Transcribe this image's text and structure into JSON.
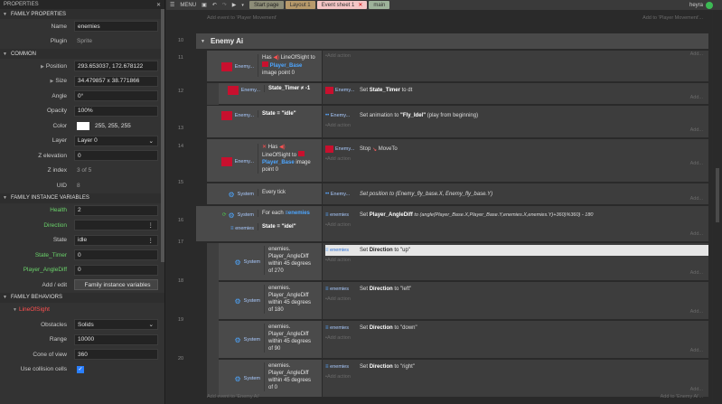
{
  "properties": {
    "title": "PROPERTIES",
    "sections": {
      "family_properties": "FAMILY PROPERTIES",
      "common": "COMMON",
      "instance_vars": "FAMILY INSTANCE VARIABLES",
      "behaviors": "FAMILY BEHAVIORS"
    },
    "name_label": "Name",
    "name_value": "enemies",
    "plugin_label": "Plugin",
    "plugin_value": "Sprite",
    "position_label": "Position",
    "position_value": "293.653037, 172.678122",
    "size_label": "Size",
    "size_value": "34.479857 x 38.771866",
    "angle_label": "Angle",
    "angle_value": "0°",
    "opacity_label": "Opacity",
    "opacity_value": "100%",
    "color_label": "Color",
    "color_value": "255, 255, 255",
    "layer_label": "Layer",
    "layer_value": "Layer 0",
    "zelev_label": "Z elevation",
    "zelev_value": "0",
    "zindex_label": "Z index",
    "zindex_value": "3 of 5",
    "uid_label": "UID",
    "uid_value": "8",
    "health_label": "Health",
    "health_value": "2",
    "direction_label": "Direction",
    "direction_value": "",
    "state_label": "State",
    "state_value": "idle",
    "statetimer_label": "State_Timer",
    "statetimer_value": "0",
    "angdiff_label": "Player_AngleDiff",
    "angdiff_value": "0",
    "addedit_label": "Add / edit",
    "addedit_button": "Family instance variables",
    "behavior_name": "LineOfSight",
    "obstacles_label": "Obstacles",
    "obstacles_value": "Solids",
    "range_label": "Range",
    "range_value": "10000",
    "cone_label": "Cone of view",
    "cone_value": "360",
    "usecoll_label": "Use collision cells"
  },
  "topbar": {
    "menu": "MENU",
    "tabs": [
      "Start page",
      "Layout 1",
      "Event sheet 1",
      "main"
    ],
    "user": "heyra"
  },
  "sheet": {
    "add_event_top": "Add event to 'Player Movement'",
    "add_to_top": "Add to 'Player Movement'...",
    "group_title": "Enemy Ai",
    "add_action": "Add action",
    "add": "Add...",
    "add_event_bottom": "Add event to 'Enemy Ai'",
    "add_to_bottom": "Add to 'Enemy Ai'...",
    "events": [
      {
        "num": "11",
        "cobj": "Enemy...",
        "ctext1": "Has",
        "ctext2": "LineOfSight to",
        "ctext3": "Player_Base",
        "ctext4": "image point 0"
      },
      {
        "num": "12",
        "cobj": "Enemy...",
        "ctext": "State_Timer ≠ -1",
        "aobj": "Enemy...",
        "atext_pre": "Set",
        "atext_b": "State_Timer",
        "atext_post": "to dt"
      },
      {
        "num": "13",
        "cobj": "Enemy...",
        "ctext": "State = \"idle\"",
        "aobj": "Enemy...",
        "atext_pre": "Set animation to",
        "atext_b": "\"Fly_Idel\"",
        "atext_post": "(play from beginning)"
      },
      {
        "num": "14",
        "cobj": "Enemy...",
        "ctext1": "Has",
        "ctext2": "LineOfSight to",
        "ctext3": "Player_Base",
        "ctext4": "image",
        "ctext5": "point 0",
        "aobj": "Enemy...",
        "atext_pre": "Stop",
        "atext_post": "MoveTo"
      },
      {
        "num": "15",
        "cobj": "System",
        "ctext": "Every tick",
        "aobj": "Enemy...",
        "atext": "Set position to (Enemy_fly_base.X, Enemy_fly_base.Y)"
      },
      {
        "num": "16",
        "cobj": "System",
        "ctext": "For each",
        "ctext_obj": "enemies",
        "cobj2": "enemies",
        "ctext2": "State = \"idel\"",
        "aobj": "enemies",
        "atext_pre": "Set",
        "atext_b": "Player_AngleDiff",
        "atext_post": "to (angle(Player_Base.X,Player_Base.Y,enemies.X,enemies.Y)+360)%360) - 180"
      },
      {
        "num": "17",
        "cobj": "System",
        "ctext": [
          "enemies.",
          "Player_AngleDiff",
          "within 45 degrees",
          "of 270"
        ],
        "aobj": "enemies",
        "atext_pre": "Set",
        "atext_b": "Direction",
        "atext_post": "to \"up\""
      },
      {
        "num": "18",
        "cobj": "System",
        "ctext": [
          "enemies.",
          "Player_AngleDiff",
          "within 45 degrees",
          "of 180"
        ],
        "aobj": "enemies",
        "atext_pre": "Set",
        "atext_b": "Direction",
        "atext_post": "to \"left\""
      },
      {
        "num": "19",
        "cobj": "System",
        "ctext": [
          "enemies.",
          "Player_AngleDiff",
          "within 45 degrees",
          "of 90"
        ],
        "aobj": "enemies",
        "atext_pre": "Set",
        "atext_b": "Direction",
        "atext_post": "to \"down\""
      },
      {
        "num": "20",
        "cobj": "System",
        "ctext": [
          "enemies.",
          "Player_AngleDiff",
          "within 45 degrees",
          "of 0"
        ],
        "aobj": "enemies",
        "atext_pre": "Set",
        "atext_b": "Direction",
        "atext_post": "to \"right\""
      }
    ]
  }
}
